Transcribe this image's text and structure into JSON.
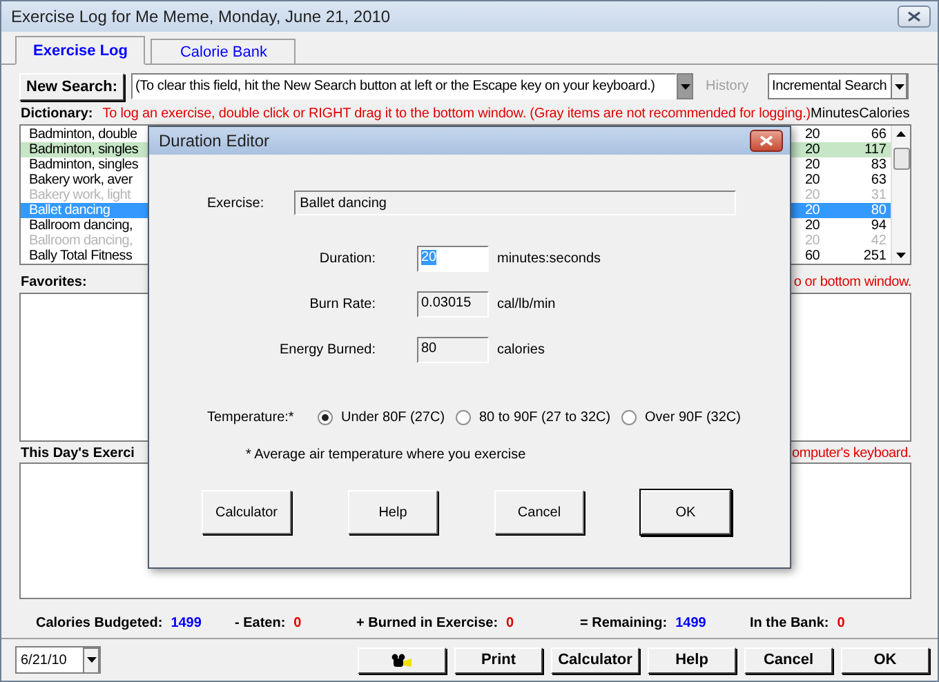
{
  "window": {
    "title": "Exercise Log for Me Meme, Monday, June 21, 2010"
  },
  "tabs": [
    {
      "label": "Exercise Log",
      "selected": true
    },
    {
      "label": "Calorie Bank",
      "selected": false
    }
  ],
  "search": {
    "button": "New Search:",
    "value": "(To clear this field, hit the New Search button at left or the Escape key on your keyboard.)",
    "history": "History",
    "mode": "Incremental Search"
  },
  "dictionary": {
    "label": "Dictionary:",
    "hint": "To log an exercise, double click or RIGHT drag it to the bottom window. (Gray items are not recommended for logging.)",
    "columns": [
      "Minutes",
      "Calories"
    ],
    "rows": [
      {
        "name": "Badminton, double",
        "minutes": "20",
        "calories": "66",
        "kind": "normal",
        "selected": false
      },
      {
        "name": "Badminton, singles",
        "minutes": "20",
        "calories": "117",
        "kind": "favorite",
        "selected": false
      },
      {
        "name": "Badminton, singles",
        "minutes": "20",
        "calories": "83",
        "kind": "normal",
        "selected": false
      },
      {
        "name": "Bakery work, aver",
        "minutes": "20",
        "calories": "63",
        "kind": "normal",
        "selected": false
      },
      {
        "name": "Bakery work, light",
        "minutes": "20",
        "calories": "31",
        "kind": "gray",
        "selected": false
      },
      {
        "name": "Ballet dancing",
        "minutes": "20",
        "calories": "80",
        "kind": "normal",
        "selected": true
      },
      {
        "name": "Ballroom dancing,",
        "minutes": "20",
        "calories": "94",
        "kind": "normal",
        "selected": false
      },
      {
        "name": "Ballroom dancing,",
        "minutes": "20",
        "calories": "42",
        "kind": "gray",
        "selected": false
      },
      {
        "name": "Bally Total Fitness",
        "minutes": "60",
        "calories": "251",
        "kind": "normal",
        "selected": false
      }
    ]
  },
  "favorites": {
    "label": "Favorites:",
    "hint": "o or bottom window."
  },
  "day_log": {
    "label": "This Day's Exerci",
    "hint": "omputer's keyboard."
  },
  "totals": [
    {
      "label": "Calories Budgeted:",
      "value": "1499",
      "color": "#0000ff"
    },
    {
      "label": "- Eaten:",
      "value": "0",
      "color": "#e00000"
    },
    {
      "label": "+ Burned in Exercise:",
      "value": "0",
      "color": "#e00000"
    },
    {
      "label": "= Remaining:",
      "value": "1499",
      "color": "#0000ff"
    },
    {
      "label": "In the Bank:",
      "value": "0",
      "color": "#e00000"
    }
  ],
  "date": "6/21/10",
  "buttons": [
    {
      "kind": "icon"
    },
    {
      "kind": "text",
      "label": "Print"
    },
    {
      "kind": "text",
      "label": "Calculator"
    },
    {
      "kind": "text",
      "label": "Help"
    },
    {
      "kind": "text",
      "label": "Cancel"
    },
    {
      "kind": "text",
      "label": "OK"
    }
  ],
  "dialog": {
    "title": "Duration Editor",
    "exercise_label": "Exercise:",
    "exercise": "Ballet dancing",
    "fields": [
      {
        "label": "Duration:",
        "value": "20",
        "unit": "minutes:seconds",
        "disabled": false
      },
      {
        "label": "Burn Rate:",
        "value": "0.03015",
        "unit": "cal/lb/min",
        "disabled": true
      },
      {
        "label": "Energy Burned:",
        "value": "80",
        "unit": "calories",
        "disabled": true
      }
    ],
    "temperature": {
      "label": "Temperature:*",
      "options": [
        {
          "label": "Under 80F (27C)",
          "selected": true
        },
        {
          "label": "80 to 90F (27 to 32C)",
          "selected": false
        },
        {
          "label": "Over 90F (32C)",
          "selected": false
        }
      ]
    },
    "note": "* Average air temperature where you exercise",
    "buttons": [
      {
        "label": "Calculator",
        "default": false
      },
      {
        "label": "Help",
        "default": false
      },
      {
        "label": "Cancel",
        "default": false
      },
      {
        "label": "OK",
        "default": true
      }
    ]
  }
}
